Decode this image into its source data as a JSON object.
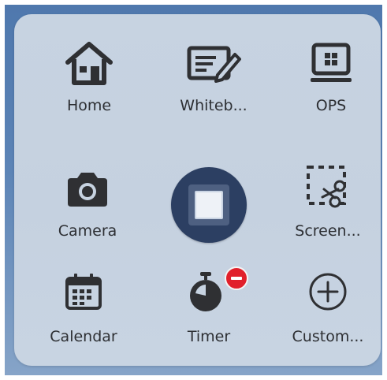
{
  "quick_menu": {
    "items": [
      {
        "label": "Home",
        "icon": "home-icon"
      },
      {
        "label": "Whiteb...",
        "icon": "whiteboard-icon"
      },
      {
        "label": "OPS",
        "icon": "ops-icon"
      },
      {
        "label": "Camera",
        "icon": "camera-icon"
      },
      {
        "label": "Screen...",
        "icon": "screenshot-icon"
      },
      {
        "label": "Calendar",
        "icon": "calendar-icon"
      },
      {
        "label": "Timer",
        "icon": "timer-icon"
      },
      {
        "label": "Custom...",
        "icon": "plus-circle-icon"
      }
    ],
    "center_button": {
      "icon": "stop-square-icon"
    },
    "timer_badge": {
      "icon": "minus-badge-icon",
      "color": "#e1202b"
    }
  },
  "colors": {
    "panel": "#c7d3e1",
    "background": "#5c84b6",
    "center_button": "#2c3f62",
    "icon": "#2f3033",
    "label": "#2d2f33"
  }
}
